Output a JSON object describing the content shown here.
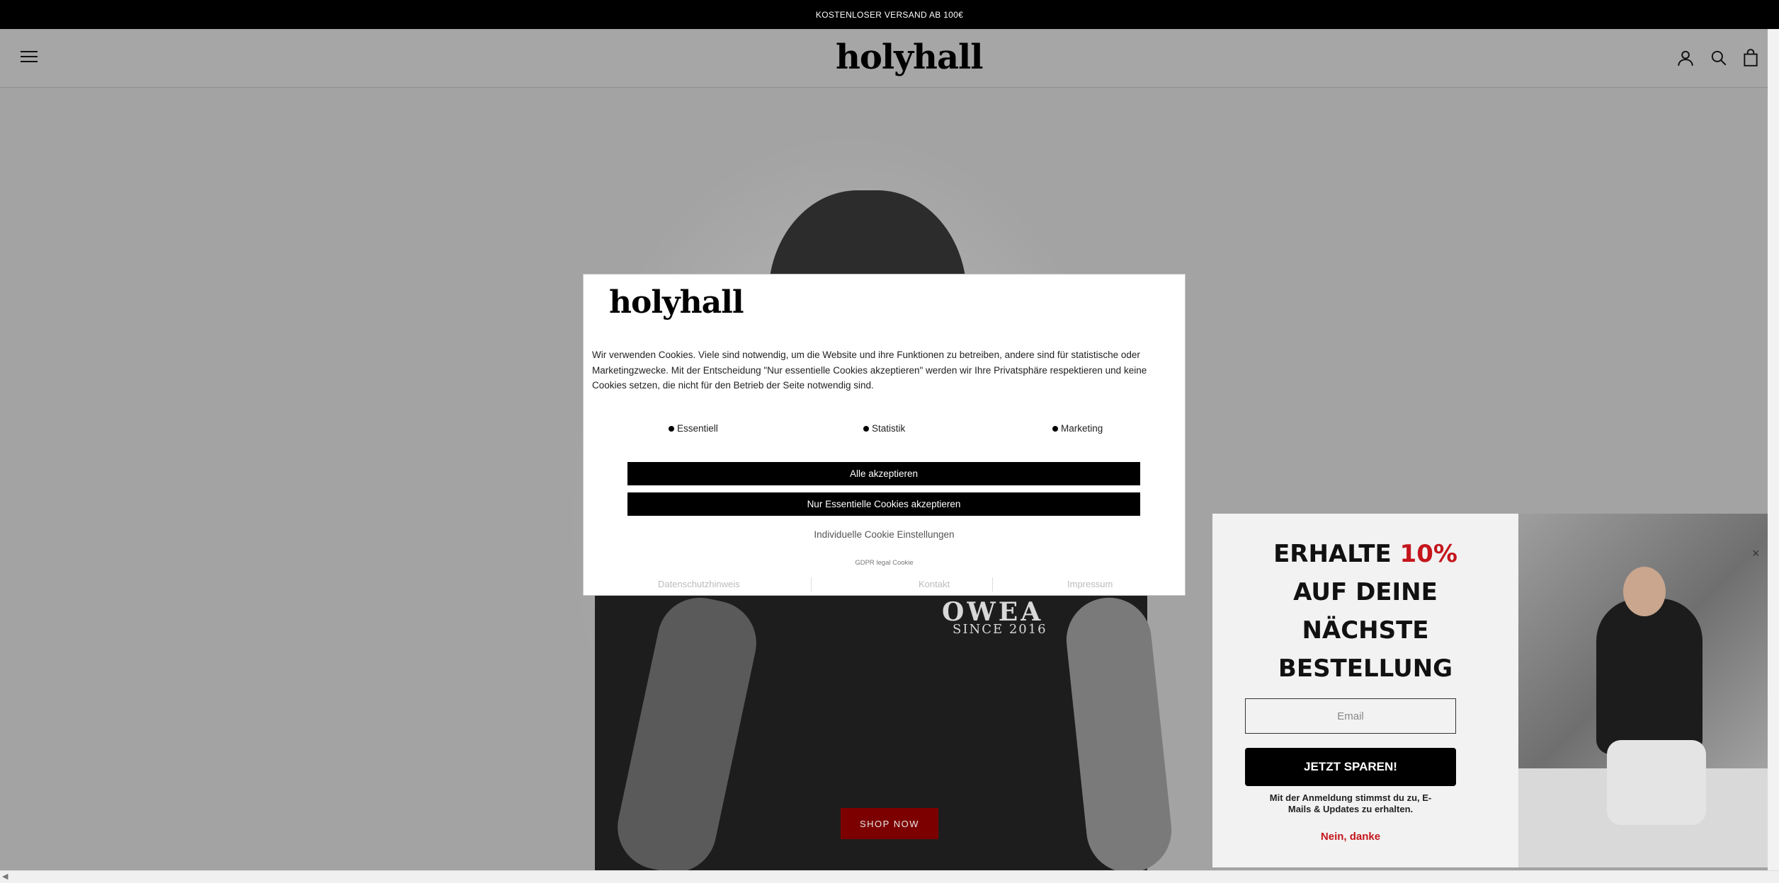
{
  "announcement": "KOSTENLOSER VERSAND AB 100€",
  "header": {
    "logo": "holyhall",
    "icons": [
      "menu-icon",
      "account-icon",
      "search-icon",
      "cart-icon"
    ]
  },
  "hero": {
    "shirt_print": "OWEA",
    "shirt_print_sub": "SINCE 2016",
    "shop_now": "SHOP NOW"
  },
  "cookie_modal": {
    "logo": "holyhall",
    "text": "Wir verwenden Cookies. Viele sind notwendig, um die Website und ihre Funktionen zu betreiben, andere sind für statistische oder Marketingzwecke. Mit der Entscheidung \"Nur essentielle Cookies akzeptieren\" werden wir Ihre Privatsphäre respektieren und keine Cookies setzen, die nicht für den Betrieb der Seite notwendig sind.",
    "categories": [
      "Essentiell",
      "Statistik",
      "Marketing"
    ],
    "accept_all": "Alle akzeptieren",
    "accept_essential": "Nur Essentielle Cookies akzeptieren",
    "individual": "Individuelle Cookie Einstellungen",
    "gdpr": "GDPR legal Cookie",
    "links": [
      "Datenschutzhinweis",
      "Kontakt",
      "Impressum"
    ]
  },
  "promo": {
    "title_part1": "ERHALTE ",
    "title_highlight": "10%",
    "title_part2": "AUF DEINE NÄCHSTE BESTELLUNG",
    "email_placeholder": "Email",
    "cta": "JETZT SPAREN!",
    "consent": "Mit der Anmeldung stimmst du zu, E-Mails & Updates zu erhalten.",
    "decline": "Nein, danke",
    "close": "×"
  },
  "colors": {
    "accent_red": "#c4161c",
    "shop_now_bg": "#7d0000",
    "black": "#000000"
  }
}
